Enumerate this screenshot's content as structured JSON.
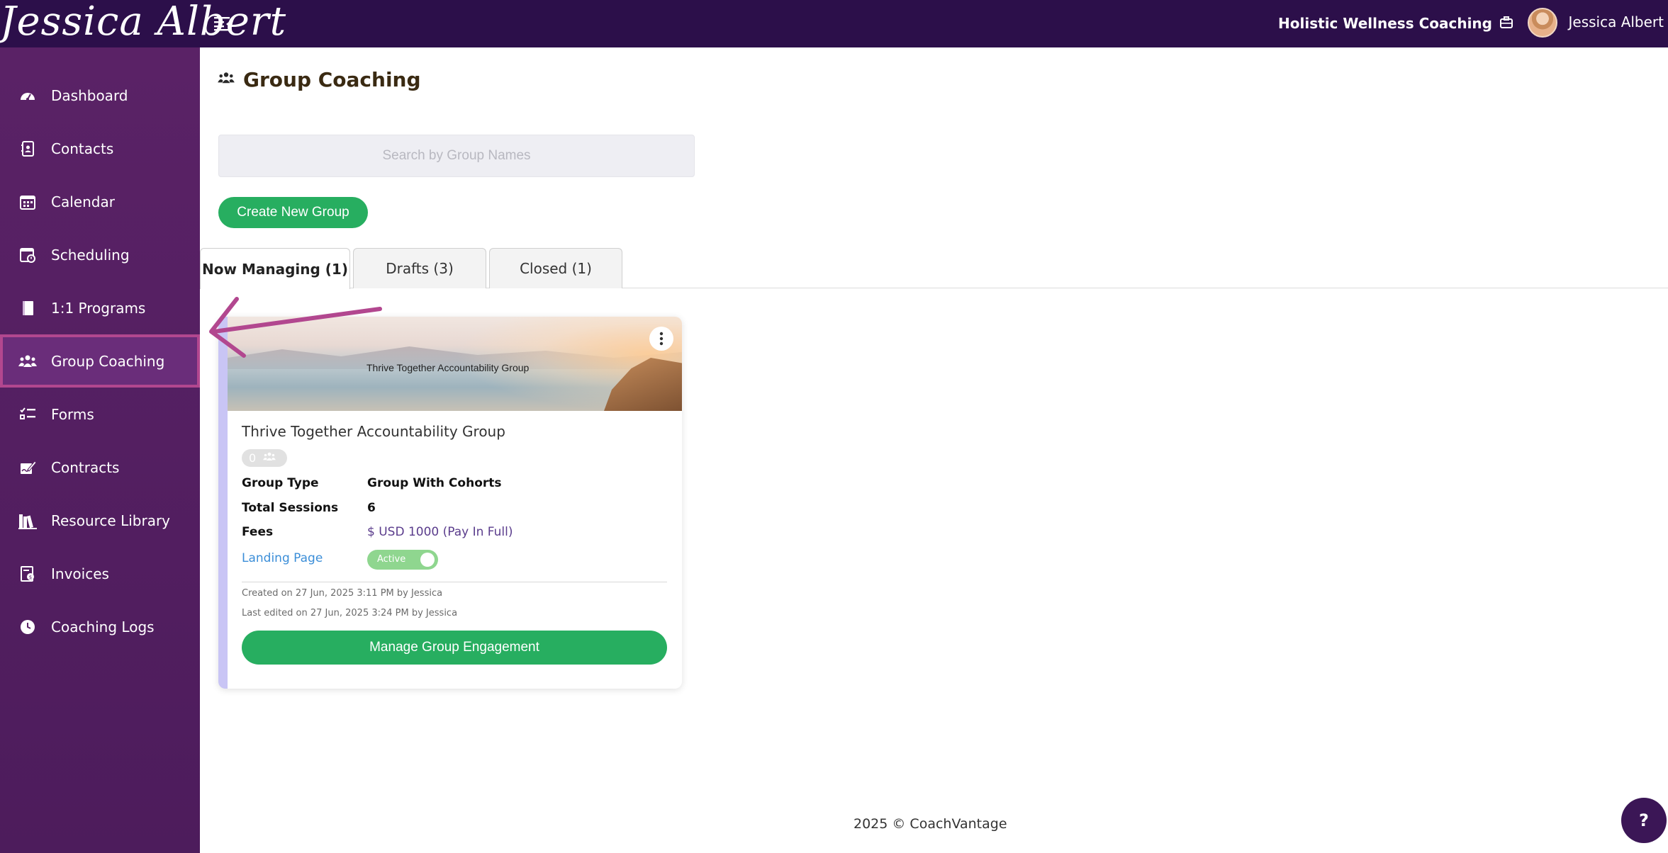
{
  "header": {
    "logo_text": "Jessica Albert",
    "org_name": "Holistic Wellness Coaching",
    "user_name": "Jessica Albert"
  },
  "sidebar": {
    "items": [
      {
        "label": "Dashboard",
        "icon": "dashboard-icon"
      },
      {
        "label": "Contacts",
        "icon": "contacts-icon"
      },
      {
        "label": "Calendar",
        "icon": "calendar-icon"
      },
      {
        "label": "Scheduling",
        "icon": "scheduling-icon"
      },
      {
        "label": "1:1 Programs",
        "icon": "book-icon"
      },
      {
        "label": "Group Coaching",
        "icon": "group-icon",
        "active": true
      },
      {
        "label": "Forms",
        "icon": "checklist-icon"
      },
      {
        "label": "Contracts",
        "icon": "signature-icon"
      },
      {
        "label": "Resource Library",
        "icon": "library-icon"
      },
      {
        "label": "Invoices",
        "icon": "invoice-icon"
      },
      {
        "label": "Coaching Logs",
        "icon": "clock-icon"
      }
    ]
  },
  "main": {
    "title": "Group Coaching",
    "search": {
      "placeholder": "Search by Group Names",
      "value": ""
    },
    "create_label": "Create New Group",
    "tabs": [
      {
        "label": "Now Managing (1)",
        "active": true
      },
      {
        "label": "Drafts (3)"
      },
      {
        "label": "Closed (1)"
      }
    ]
  },
  "card": {
    "banner_title": "Thrive Together Accountability Group",
    "title": "Thrive Together Accountability Group",
    "member_count": "0",
    "rows": [
      {
        "label": "Group Type",
        "value": "Group With Cohorts"
      },
      {
        "label": "Total Sessions",
        "value": "6"
      },
      {
        "label": "Fees",
        "value": "$ USD 1000 (Pay In Full)"
      }
    ],
    "landing_page_label": "Landing Page",
    "landing_status": "Active",
    "created": "Created on 27 Jun, 2025 3:11 PM by Jessica",
    "edited": "Last edited on 27 Jun, 2025 3:24 PM by Jessica",
    "manage_label": "Manage Group Engagement"
  },
  "footer": {
    "text": "2025 © CoachVantage"
  },
  "help_label": "?",
  "colors": {
    "topbar": "#2c0f4a",
    "sidebar": "#5a2266",
    "primary_green": "#27ae60",
    "annotation": "#b2478f"
  }
}
